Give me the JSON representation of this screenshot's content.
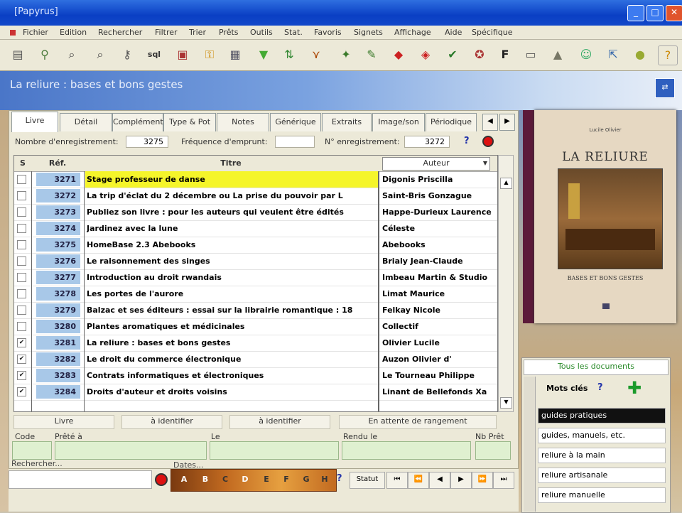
{
  "window": {
    "title": "[Papyrus]"
  },
  "menu": [
    "Fichier",
    "Edition",
    "Rechercher",
    "Filtrer",
    "Trier",
    "Prêts",
    "Outils",
    "Stat.",
    "Favoris",
    "Signets",
    "Affichage",
    "Aide",
    "Spécifique"
  ],
  "banner": {
    "title": "La reliure : bases et bons gestes"
  },
  "tabs": [
    "Livre",
    "Détail",
    "Complément",
    "Type & Pot",
    "Notes",
    "Générique",
    "Extraits",
    "Image/son",
    "Périodique"
  ],
  "info": {
    "nb_label": "Nombre d'enregistrement:",
    "nb_value": "3275",
    "freq_label": "Fréquence d'emprunt:",
    "freq_value": "",
    "num_label": "N° enregistrement:",
    "num_value": "3272",
    "help": "?"
  },
  "grid": {
    "headers": {
      "s": "S",
      "ref": "Réf.",
      "titre": "Titre",
      "auteur": "Auteur"
    },
    "rows": [
      {
        "checked": "",
        "ref": "3271",
        "titre": "Stage professeur de danse",
        "auteur": "Digonis Priscilla"
      },
      {
        "checked": "",
        "ref": "3272",
        "titre": "La trip d'éclat du 2 décembre ou La prise du pouvoir par L",
        "auteur": "Saint-Bris Gonzague"
      },
      {
        "checked": "",
        "ref": "3273",
        "titre": "Publiez son livre : pour les auteurs qui veulent être édités",
        "auteur": "Happe-Durieux Laurence"
      },
      {
        "checked": "",
        "ref": "3274",
        "titre": "Jardinez avec la lune",
        "auteur": "Céleste"
      },
      {
        "checked": "",
        "ref": "3275",
        "titre": "HomeBase 2.3 Abebooks",
        "auteur": "Abebooks"
      },
      {
        "checked": "",
        "ref": "3276",
        "titre": "Le raisonnement des singes",
        "auteur": "Brialy Jean-Claude"
      },
      {
        "checked": "",
        "ref": "3277",
        "titre": "Introduction au droit rwandais",
        "auteur": "Imbeau Martin &  Studio"
      },
      {
        "checked": "",
        "ref": "3278",
        "titre": "Les portes de l'aurore",
        "auteur": "Limat Maurice"
      },
      {
        "checked": "",
        "ref": "3279",
        "titre": "Balzac et ses éditeurs :  essai sur la librairie romantique : 18",
        "auteur": "Felkay Nicole"
      },
      {
        "checked": "",
        "ref": "3280",
        "titre": "Plantes aromatiques et médicinales",
        "auteur": "Collectif"
      },
      {
        "checked": "✔",
        "ref": "3281",
        "titre": "La reliure :  bases et bons gestes",
        "auteur": "Olivier Lucile"
      },
      {
        "checked": "✔",
        "ref": "3282",
        "titre": "Le droit du commerce électronique",
        "auteur": "Auzon Olivier d'"
      },
      {
        "checked": "✔",
        "ref": "3283",
        "titre": "Contrats informatiques et électroniques",
        "auteur": "Le Tourneau Philippe"
      },
      {
        "checked": "✔",
        "ref": "3284",
        "titre": "Droits d'auteur et droits voisins",
        "auteur": "Linant de Bellefonds Xa"
      }
    ]
  },
  "statusbar": [
    "Livre",
    "à identifier",
    "à identifier",
    "En attente de rangement"
  ],
  "loan": {
    "code": "Code",
    "prete_a": "Prêté à",
    "le": "Le",
    "rendu_le": "Rendu le",
    "nb_pret": "Nb Prêt"
  },
  "bottom": {
    "rechercher": "Rechercher...",
    "dates": "Dates...",
    "letters": [
      "A",
      "B",
      "C",
      "D",
      "E",
      "F",
      "G",
      "H"
    ],
    "help": "?",
    "statut": "Statut"
  },
  "book": {
    "author": "Lucile Olivier",
    "title": "LA RELIURE",
    "subtitle": "BASES ET BONS GESTES"
  },
  "motscles": {
    "all_docs": "Tous les documents",
    "title": "Mots clés",
    "help": "?",
    "items": [
      "guides pratiques",
      "guides, manuels, etc.",
      "reliure à la main",
      "reliure artisanale",
      "reliure manuelle"
    ]
  }
}
